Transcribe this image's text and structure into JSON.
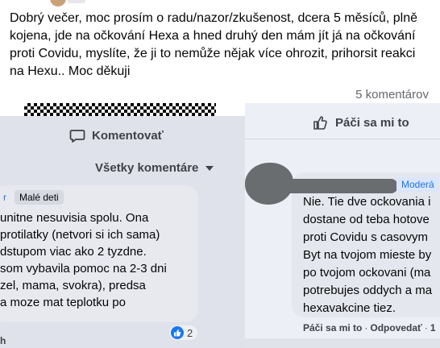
{
  "post": {
    "text": "Dobrý večer, moc prosím o radu/nazor/zkušenost, dcera 5 měsíců, plně kojena, jde na očkování Hexa a hned druhý den mám jít já na očkování proti Covidu, myslíte, že ji to nemůže nějak více ohrozit, prihorsit reakci na Hexu.. Moc děkuji",
    "comments_count": "5 komentárov"
  },
  "left_panel": {
    "comment_action": "Komentovať",
    "all_comments": "Všetky komentáre",
    "badge_partial": "r",
    "badge": "Malé deti",
    "comment_text": "unitne nesuvisia spolu. Ona\nprotilatky (netvori si ich sama)\ndstupom viac ako 2 tyzdne.\nsom vybavila pomoc na 2-3 dni\nzel, mama, svokra), predsa\na moze mat teplotku po",
    "reaction_count": "2",
    "footer_partial": "h"
  },
  "right_panel": {
    "like_action": "Páči sa mi to",
    "moderator_badge": "Moderá",
    "comment_text": "Nie. Tie dve ockovania i\ndostane od teba hotove\nproti Covidu s casovym\nByt na tvojom mieste by\npo tvojom ockovani (ma\npotrebujes oddych a ma\nhexavakcine tiez.",
    "footer": {
      "like": "Páči sa mi to",
      "reply": "Odpovedať",
      "time": "1"
    }
  },
  "colors": {
    "facebook_blue": "#1877f2",
    "text_dark": "#050505",
    "text_muted": "#65676b"
  },
  "icons": [
    "comment-bubble-icon",
    "thumbs-up-icon",
    "chevron-down-icon",
    "like-reaction-icon"
  ]
}
